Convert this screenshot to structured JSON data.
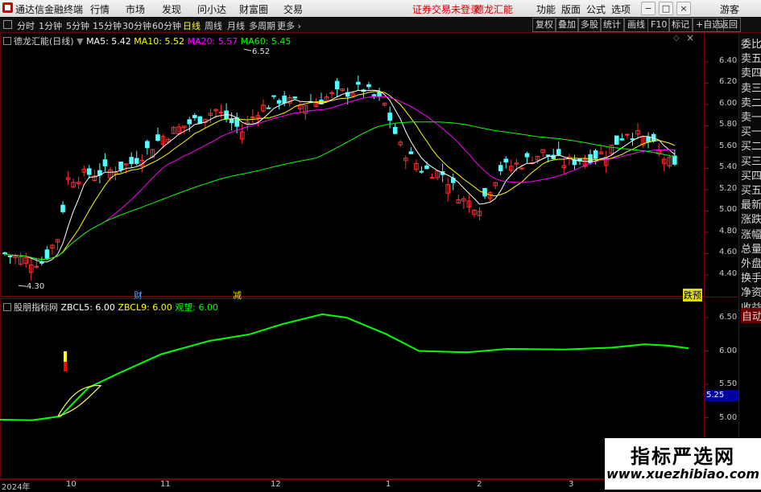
{
  "menubar": {
    "app_title": "通达信金融终端",
    "items": [
      "行情",
      "市场",
      "发现",
      "问小达",
      "财富圈",
      "交易"
    ],
    "status_text": "证券交易未登录",
    "stock_name": "德龙汇能",
    "right_items": [
      "功能",
      "版面",
      "公式",
      "选项"
    ],
    "guest": "游客",
    "window_buttons": [
      "−",
      "□",
      "×"
    ]
  },
  "periodbar": {
    "periods": [
      "分时",
      "1分钟",
      "5分钟",
      "15分钟",
      "30分钟",
      "60分钟",
      "日线",
      "周线",
      "月线",
      "多周期",
      "更多"
    ],
    "active_period": "日线",
    "tools": [
      "复权",
      "叠加",
      "多股",
      "统计",
      "画线",
      "F10",
      "标记",
      "+自选",
      "返回"
    ]
  },
  "main_chart": {
    "title": "德龙汇能(日线)",
    "ma5_label": "MA5: 5.42",
    "ma10_label": "MA10: 5.52",
    "ma20_label": "MA20: 5.57",
    "ma60_label": "MA60: 5.45",
    "high_label": "6.52",
    "low_label": "4.30",
    "events": [
      "财",
      "减",
      "跌预"
    ],
    "y_ticks": [
      "6.40",
      "6.20",
      "6.00",
      "5.80",
      "5.60",
      "5.40",
      "5.20",
      "5.00",
      "4.80",
      "4.60",
      "4.40"
    ]
  },
  "indicator": {
    "title": "股朋指标网",
    "zbcl5": "ZBCL5: 6.00",
    "zbcl9": "ZBCL9: 6.00",
    "watch": "观望: 6.00",
    "y_ticks": [
      "6.50",
      "6.00",
      "5.50",
      "5.00"
    ],
    "current_value": "5.25"
  },
  "x_axis": [
    "2024年",
    "10",
    "11",
    "12",
    "1",
    "2",
    "3"
  ],
  "side_panel": [
    "委比",
    "卖五",
    "卖四",
    "卖三",
    "卖二",
    "卖一",
    "买一",
    "买二",
    "买三",
    "买四",
    "买五",
    "最新",
    "涨跌",
    "涨幅",
    "总量",
    "外盘",
    "换手",
    "净资",
    "收益",
    "自动"
  ],
  "watermark": {
    "title": "指标严选网",
    "url": "www.xuezhibiao.com"
  },
  "colors": {
    "up": "#ff3232",
    "down": "#54ffff",
    "ma5": "#ffffff",
    "ma10": "#ffff00",
    "ma20": "#ff00ff",
    "ma60": "#00ff00",
    "indicator_line": "#00ff00",
    "frame": "#6a0000"
  }
}
